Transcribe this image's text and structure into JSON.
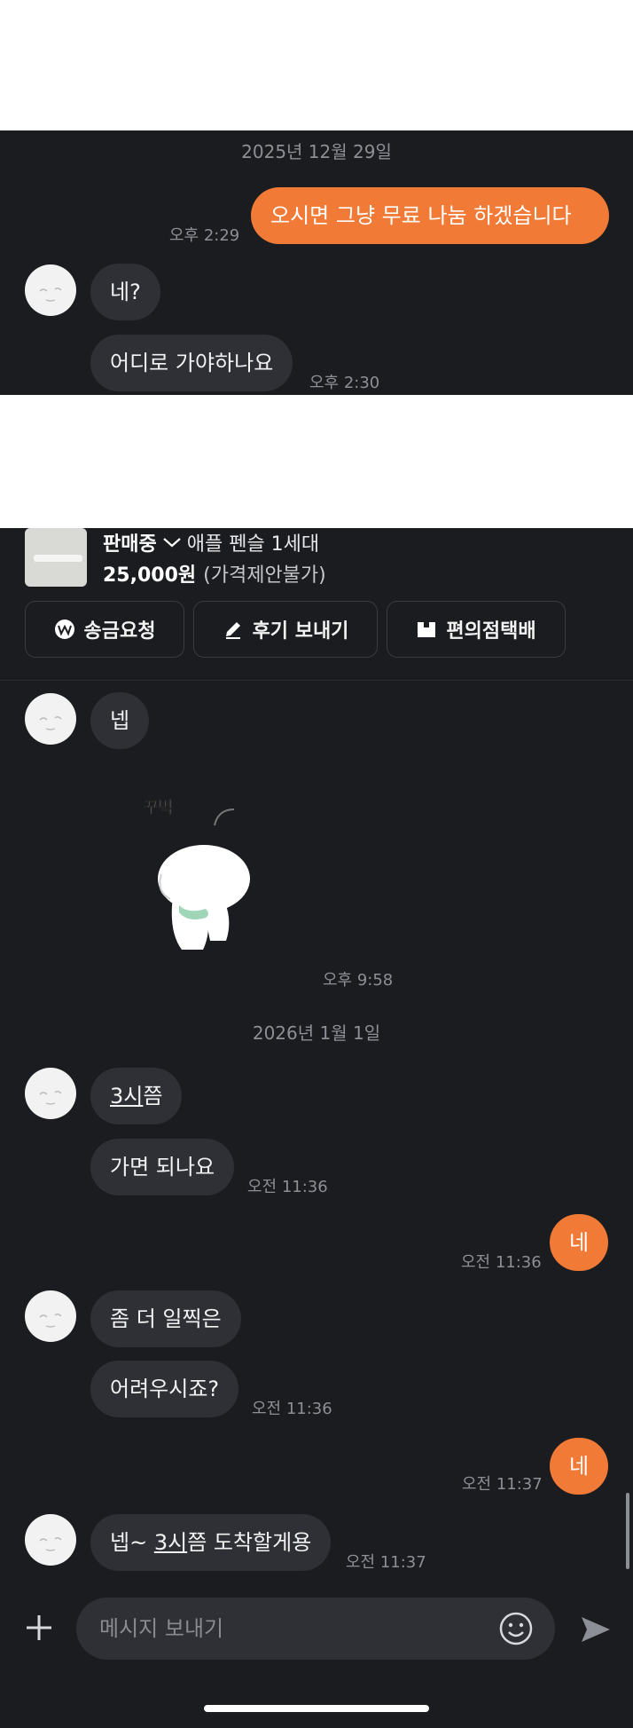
{
  "top": {
    "date": "2025년 12월 29일",
    "out_message": "오시면 그냥 무료 나눔 하겠습니다",
    "out_time": "오후 2:29",
    "in_messages": [
      "네?",
      "어디로 가야하나요"
    ],
    "in_time": "오후 2:30"
  },
  "product": {
    "status": "판매중",
    "name": "애플 펜슬 1세대",
    "price": "25,000원",
    "price_note": "(가격제안불가)"
  },
  "actions": [
    "송금요청",
    "후기 보내기",
    "편의점택배"
  ],
  "chat": {
    "msg_1": "넵",
    "sticker_text": "꾸벅",
    "sticker_time": "오후 9:58",
    "date": "2026년 1월 1일",
    "msg_2_underlined": "3시",
    "msg_2_rest": "쯤",
    "msg_3": "가면 되나요",
    "time_1": "오전 11:36",
    "out_1": "네",
    "out_1_time": "오전 11:36",
    "msg_4": "좀 더 일찍은",
    "msg_5": "어려우시죠?",
    "time_2": "오전 11:36",
    "out_2": "네",
    "out_2_time": "오전 11:37",
    "msg_6_pre": "넵~ ",
    "msg_6_underlined": "3시",
    "msg_6_post": "쯤 도착할게용",
    "time_3": "오전 11:37"
  },
  "input": {
    "placeholder": "메시지 보내기"
  },
  "colors": {
    "background": "#1b1c20",
    "bubble_in": "#2f3036",
    "bubble_out": "#f07a36",
    "muted_text": "#8d8f96"
  },
  "icons": [
    "plus-icon",
    "emoji-icon",
    "send-icon",
    "won-icon",
    "pen-icon",
    "box-icon",
    "chevron-down-icon"
  ]
}
